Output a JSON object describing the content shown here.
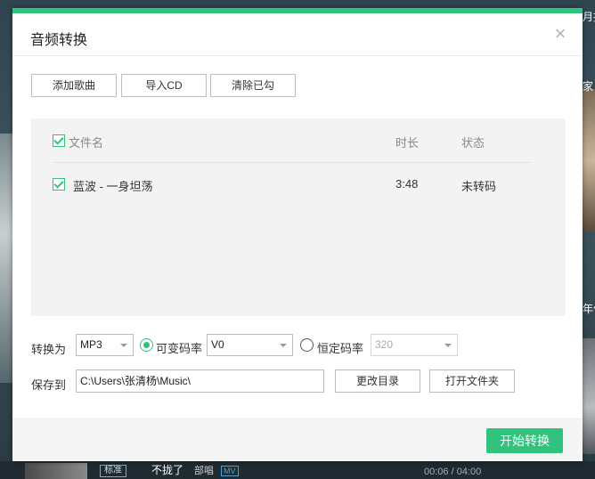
{
  "background": {
    "right_text_top": "月推",
    "right_text_mid": "家",
    "right_text_lower": "年价",
    "bottom": {
      "badge": "标准",
      "song": "不拢了",
      "artist": "部唱",
      "mv": "MV",
      "time": "00:06 / 04:00"
    }
  },
  "dialog": {
    "title": "音频转换",
    "close_symbol": "×",
    "toolbar": {
      "add_song": "添加歌曲",
      "import_cd": "导入CD",
      "clear_checked": "清除已勾"
    },
    "list": {
      "headers": {
        "filename": "文件名",
        "duration": "时长",
        "status": "状态"
      },
      "rows": [
        {
          "name": "蓝波 - 一身坦荡",
          "duration": "3:48",
          "status": "未转码",
          "checked": true
        }
      ]
    },
    "convert": {
      "label": "转换为",
      "format": "MP3",
      "vbr_label": "可变码率",
      "vbr_value": "V0",
      "cbr_label": "恒定码率",
      "cbr_value": "320",
      "selected_mode": "vbr"
    },
    "save": {
      "label": "保存到",
      "path": "C:\\Users\\张清杨\\Music\\",
      "change_dir": "更改目录",
      "open_folder": "打开文件夹"
    },
    "footer": {
      "start": "开始转换"
    }
  },
  "colors": {
    "accent": "#31c27c"
  }
}
